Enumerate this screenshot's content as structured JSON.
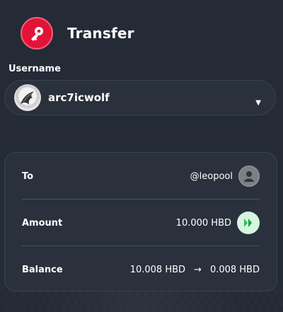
{
  "header": {
    "title": "Transfer"
  },
  "username_section": {
    "label": "Username",
    "selected_user": "arc7icwolf"
  },
  "details": {
    "to": {
      "label": "To",
      "value": "@leopool"
    },
    "amount": {
      "label": "Amount",
      "value": "10.000 HBD"
    },
    "balance": {
      "label": "Balance",
      "from": "10.008 HBD",
      "to": "0.008 HBD",
      "arrow": "→"
    }
  },
  "colors": {
    "brand": "#e31337",
    "background": "#242a36",
    "panel": "#2a303c",
    "hbd_green": "#2fbf5a"
  },
  "icons": [
    "key-icon",
    "wolf-avatar",
    "chevron-down-icon",
    "user-icon",
    "hbd-icon"
  ]
}
